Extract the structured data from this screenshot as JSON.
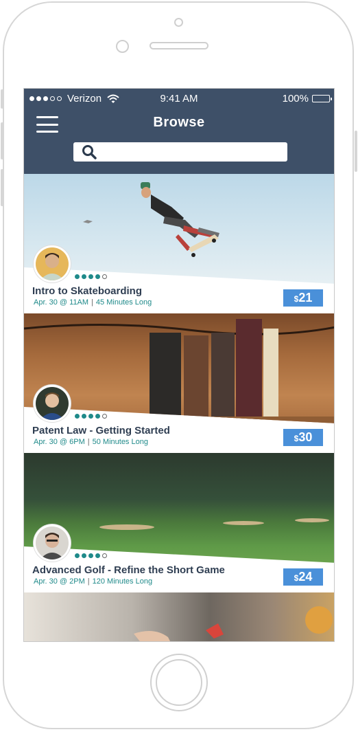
{
  "status_bar": {
    "carrier": "Verizon",
    "time": "9:41 AM",
    "battery": "100%"
  },
  "header": {
    "title": "Browse",
    "search_placeholder": ""
  },
  "cards": [
    {
      "title": "Intro to Skateboarding",
      "date": "Apr. 30 @ 11AM",
      "duration": "45 Minutes Long",
      "price_currency": "$",
      "price_amount": "21",
      "rating": 4,
      "rating_max": 5
    },
    {
      "title": "Patent Law - Getting Started",
      "date": "Apr. 30 @ 6PM",
      "duration": "50 Minutes Long",
      "price_currency": "$",
      "price_amount": "30",
      "rating": 4,
      "rating_max": 5
    },
    {
      "title": "Advanced Golf - Refine the Short Game",
      "date": "Apr. 30 @ 2PM",
      "duration": "120 Minutes Long",
      "price_currency": "$",
      "price_amount": "24",
      "rating": 4,
      "rating_max": 5
    }
  ],
  "colors": {
    "header_bg": "#3e5068",
    "accent_teal": "#1f8a8a",
    "price_blue": "#4a90d9",
    "title_dark": "#2f3e52"
  },
  "icons": {
    "menu": "hamburger-icon",
    "search": "search-icon",
    "wifi": "wifi-icon",
    "battery": "battery-icon"
  }
}
